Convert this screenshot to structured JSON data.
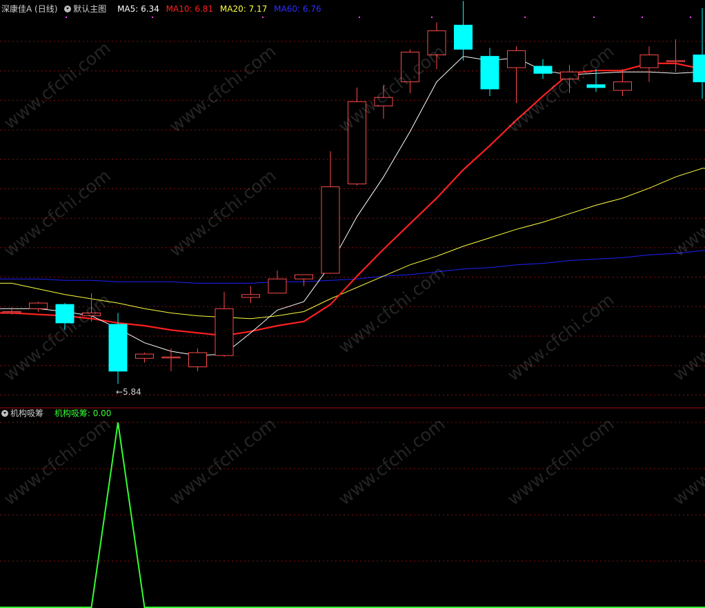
{
  "header": {
    "stock": "深康佳A (日线)",
    "template": "默认主图",
    "ma5": "MA5: 6.34",
    "ma10": "MA10: 6.81",
    "ma20": "MA20: 7.17",
    "ma60": "MA60: 6.76"
  },
  "indicator": {
    "name": "机构吸筹",
    "value": "机构吸筹: 0.00"
  },
  "low_label": "5.84",
  "watermark": "www.cfchi.com",
  "colors": {
    "up": "#ff4a4a",
    "down": "#00ffff",
    "ma5": "#ffffff",
    "ma10": "#ff2020",
    "ma20": "#ffff40",
    "ma60": "#2020ff",
    "indicator": "#33ff33",
    "grid": "#8a1010"
  },
  "chart_data": [
    {
      "type": "candlestick",
      "title": "深康佳A (日线)",
      "ylim": [
        5.7,
        8.45
      ],
      "candles": [
        {
          "o": 6.35,
          "h": 6.38,
          "l": 6.33,
          "c": 6.35
        },
        {
          "o": 6.37,
          "h": 6.42,
          "l": 6.35,
          "c": 6.41
        },
        {
          "o": 6.4,
          "h": 6.41,
          "l": 6.22,
          "c": 6.27
        },
        {
          "o": 6.32,
          "h": 6.48,
          "l": 6.28,
          "c": 6.34
        },
        {
          "o": 6.26,
          "h": 6.34,
          "l": 5.84,
          "c": 5.93
        },
        {
          "o": 6.02,
          "h": 6.06,
          "l": 5.99,
          "c": 6.05
        },
        {
          "o": 6.03,
          "h": 6.09,
          "l": 5.93,
          "c": 6.03
        },
        {
          "o": 5.96,
          "h": 6.09,
          "l": 5.93,
          "c": 6.06
        },
        {
          "o": 6.04,
          "h": 6.49,
          "l": 6.03,
          "c": 6.37
        },
        {
          "o": 6.45,
          "h": 6.53,
          "l": 6.41,
          "c": 6.47
        },
        {
          "o": 6.48,
          "h": 6.64,
          "l": 6.48,
          "c": 6.58
        },
        {
          "o": 6.58,
          "h": 6.61,
          "l": 6.53,
          "c": 6.61
        },
        {
          "o": 6.62,
          "h": 7.48,
          "l": 6.62,
          "c": 7.23
        },
        {
          "o": 7.25,
          "h": 7.93,
          "l": 7.24,
          "c": 7.83
        },
        {
          "o": 7.8,
          "h": 7.95,
          "l": 7.71,
          "c": 7.86
        },
        {
          "o": 7.97,
          "h": 8.2,
          "l": 7.89,
          "c": 8.18
        },
        {
          "o": 8.16,
          "h": 8.39,
          "l": 8.06,
          "c": 8.33
        },
        {
          "o": 8.37,
          "h": 8.54,
          "l": 8.12,
          "c": 8.2
        },
        {
          "o": 8.15,
          "h": 8.21,
          "l": 7.87,
          "c": 7.92
        },
        {
          "o": 8.07,
          "h": 8.22,
          "l": 7.82,
          "c": 8.19
        },
        {
          "o": 8.08,
          "h": 8.13,
          "l": 7.99,
          "c": 8.03
        },
        {
          "o": 7.99,
          "h": 8.09,
          "l": 7.89,
          "c": 8.04
        },
        {
          "o": 7.95,
          "h": 8.06,
          "l": 7.9,
          "c": 7.93
        },
        {
          "o": 7.91,
          "h": 8.06,
          "l": 7.87,
          "c": 7.97
        },
        {
          "o": 8.07,
          "h": 8.22,
          "l": 7.97,
          "c": 8.16
        },
        {
          "o": 8.12,
          "h": 8.27,
          "l": 8.04,
          "c": 8.12
        },
        {
          "o": 8.16,
          "h": 8.49,
          "l": 7.85,
          "c": 7.97
        }
      ],
      "ma5": [
        6.37,
        6.37,
        6.35,
        6.32,
        6.23,
        6.13,
        6.07,
        6.04,
        6.05,
        6.2,
        6.36,
        6.42,
        6.68,
        7.02,
        7.3,
        7.62,
        7.97,
        8.15,
        8.12,
        8.14,
        8.05,
        8.02,
        8.03,
        8.04,
        8.04,
        8.03,
        8.04
      ],
      "ma10": [
        6.34,
        6.33,
        6.32,
        6.3,
        6.27,
        6.25,
        6.22,
        6.2,
        6.18,
        6.21,
        6.25,
        6.28,
        6.4,
        6.6,
        6.79,
        6.97,
        7.15,
        7.35,
        7.52,
        7.7,
        7.87,
        8.03,
        8.05,
        8.05,
        8.1,
        8.1,
        8.06
      ],
      "ma20": [
        6.55,
        6.51,
        6.47,
        6.44,
        6.41,
        6.37,
        6.34,
        6.32,
        6.31,
        6.3,
        6.32,
        6.35,
        6.44,
        6.52,
        6.6,
        6.68,
        6.74,
        6.81,
        6.87,
        6.93,
        6.98,
        7.04,
        7.1,
        7.15,
        7.22,
        7.3,
        7.36
      ],
      "ma60": [
        6.58,
        6.58,
        6.57,
        6.57,
        6.56,
        6.56,
        6.56,
        6.55,
        6.55,
        6.55,
        6.56,
        6.56,
        6.57,
        6.58,
        6.6,
        6.61,
        6.63,
        6.65,
        6.66,
        6.68,
        6.69,
        6.71,
        6.72,
        6.73,
        6.75,
        6.76,
        6.78
      ]
    },
    {
      "type": "line",
      "title": "机构吸筹",
      "ylim": [
        0,
        1
      ],
      "series": [
        {
          "name": "机构吸筹",
          "values": [
            0,
            0,
            0,
            0,
            1,
            0,
            0,
            0,
            0,
            0,
            0,
            0,
            0,
            0,
            0,
            0,
            0,
            0,
            0,
            0,
            0,
            0,
            0,
            0,
            0,
            0,
            0
          ]
        }
      ]
    }
  ]
}
